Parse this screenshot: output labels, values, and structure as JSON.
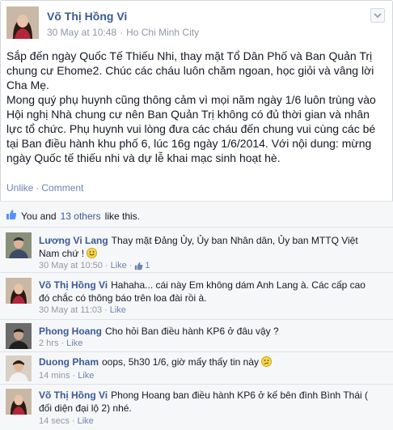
{
  "post": {
    "author": "Võ Thị Hồng Vi",
    "date": "30 May at 10:48",
    "separator": "·",
    "location": "Ho Chi Minh City",
    "paragraphs": [
      "Sắp đến ngày Quốc Tế Thiếu Nhi, thay mặt Tổ Dân Phố và Ban Quản Trị chung cư Ehome2. Chúc các cháu luôn chăm ngoan, học giỏi và vâng lời Cha Mẹ.",
      "Mong quý phụ huynh cũng thông cảm vì mọi năm ngày 1/6 luôn trùng vào Hội nghị Nhà chung cư nên Ban Quản Trị không có đủ thời gian và nhân lực tổ chức. Phụ huynh vui lòng đưa các cháu đến chung vui cùng các bé tại Ban điều hành khu phố 6, lúc 16g ngày 1/6/2014. Với nội dung: mừng ngày Quốc tế thiếu nhi và dự lễ khai mạc sinh hoạt hè."
    ],
    "unlike_label": "Unlike",
    "comment_label": "Comment",
    "action_sep": "·"
  },
  "likes": {
    "you": "You and",
    "others": "13 others",
    "tail": "like this."
  },
  "comments": [
    {
      "name": "Lương Vi Lang",
      "text": "Thay mặt Đảng Ủy, Ủy ban Nhân dân, Ủy ban MTTQ Việt Nam chứ !",
      "emoji": "smile",
      "time": "30 May at 10:50",
      "like_label": "Like",
      "like_count": "1"
    },
    {
      "name": "Võ Thị Hồng Vi",
      "text": "Hahaha... cái này Em không dám Anh Lang à. Các cấp cao đó chắc có thông báo trên loa đài rồi à.",
      "time": "30 May at 11:03",
      "like_label": "Like"
    },
    {
      "name": "Phong Hoang",
      "text": "Cho hỏi Ban điều hành KP6 ở đâu vậy ?",
      "time": "2 hrs",
      "like_label": "Like"
    },
    {
      "name": "Duong Pham",
      "text": "oops, 5h30 1/6, giờ mấy thấy tin này",
      "emoji": "confused",
      "time": "14 mins",
      "like_label": "Like"
    },
    {
      "name": "Võ Thị Hồng Vi",
      "text": "Phong Hoang ban điều hành KP6 ở kế bên đình Bình Thái ( đối diện đại lộ 2) nhé.",
      "time": "14 secs",
      "like_label": "Like"
    }
  ],
  "colors": {
    "link": "#3b5998",
    "meta": "#9197a3",
    "background_feedback": "#f6f7f8"
  },
  "icons": {
    "menu": "chevron-down-icon",
    "likes": "thumbs-up-icon",
    "comment_like": "thumbs-up-icon"
  }
}
